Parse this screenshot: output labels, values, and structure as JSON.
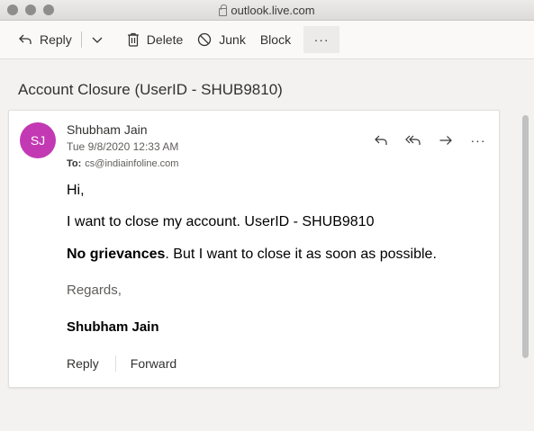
{
  "browser": {
    "url": "outlook.live.com"
  },
  "toolbar": {
    "reply_label": "Reply",
    "delete_label": "Delete",
    "junk_label": "Junk",
    "block_label": "Block",
    "more_label": "···"
  },
  "message": {
    "subject": "Account Closure (UserID - SHUB9810)",
    "avatar_initials": "SJ",
    "avatar_color": "#c239b3",
    "sender_name": "Shubham Jain",
    "date": "Tue 9/8/2020 12:33 AM",
    "to_label": "To:",
    "to_address": "cs@indiainfoline.com",
    "body": {
      "greeting": "Hi,",
      "line1": "I want to close my account. UserID - SHUB9810",
      "line2_bold": "No grievances",
      "line2_rest": ". But I want to close it as soon as possible.",
      "regards": "Regards,",
      "signature": "Shubham Jain"
    },
    "more_actions_label": "···",
    "footer": {
      "reply_label": "Reply",
      "forward_label": "Forward"
    }
  }
}
